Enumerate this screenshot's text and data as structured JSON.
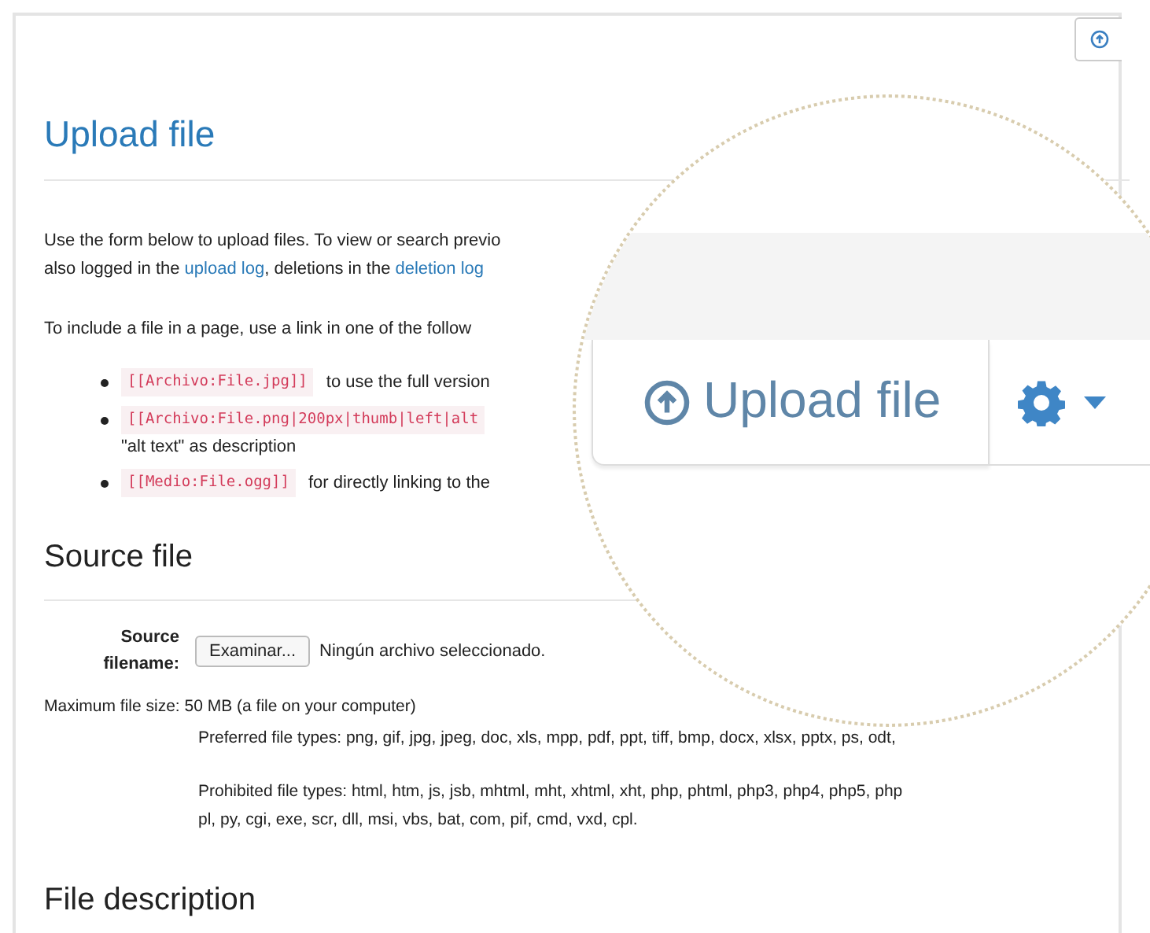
{
  "page": {
    "title": "Upload file",
    "intro": "Use the form below to upload files. To view or search previo",
    "intro_line_2": [
      {
        "kind": "text",
        "text": "also logged in the "
      },
      {
        "kind": "link",
        "text": "upload log"
      },
      {
        "kind": "text",
        "text": ", deletions in the "
      },
      {
        "kind": "link",
        "text": "deletion log"
      }
    ],
    "include_hint": "To include a file in a page, use a link in one of the follow",
    "examples": [
      {
        "code": "[[Archivo:File.jpg]]",
        "text": "to use the full version"
      },
      {
        "code": "[[Archivo:File.png|200px|thumb|left|alt",
        "text": "\"alt text\" as description"
      },
      {
        "code": "[[Medio:File.ogg]]",
        "text": "for directly linking to the"
      }
    ]
  },
  "source_file": {
    "heading": "Source file",
    "label": "Source filename:",
    "browse_button": "Examinar...",
    "file_status": "Ningún archivo seleccionado.",
    "max_size": "Maximum file size: 50 MB (a file on your computer)",
    "preferred": "Preferred file types: png, gif, jpg, jpeg, doc, xls, mpp, pdf, ppt, tiff, bmp, docx, xlsx, pptx, ps, odt,",
    "prohibited": "Prohibited file types: html, htm, js, jsb, mhtml, mht, xhtml, xht, php, phtml, php3, php4, php5, php",
    "prohibited_2": "pl, py, cgi, exe, scr, dll, msi, vbs, bat, com, pif, cmd, vxd, cpl."
  },
  "file_description": {
    "heading": "File description"
  },
  "magnifier": {
    "button": "Upload file"
  }
}
